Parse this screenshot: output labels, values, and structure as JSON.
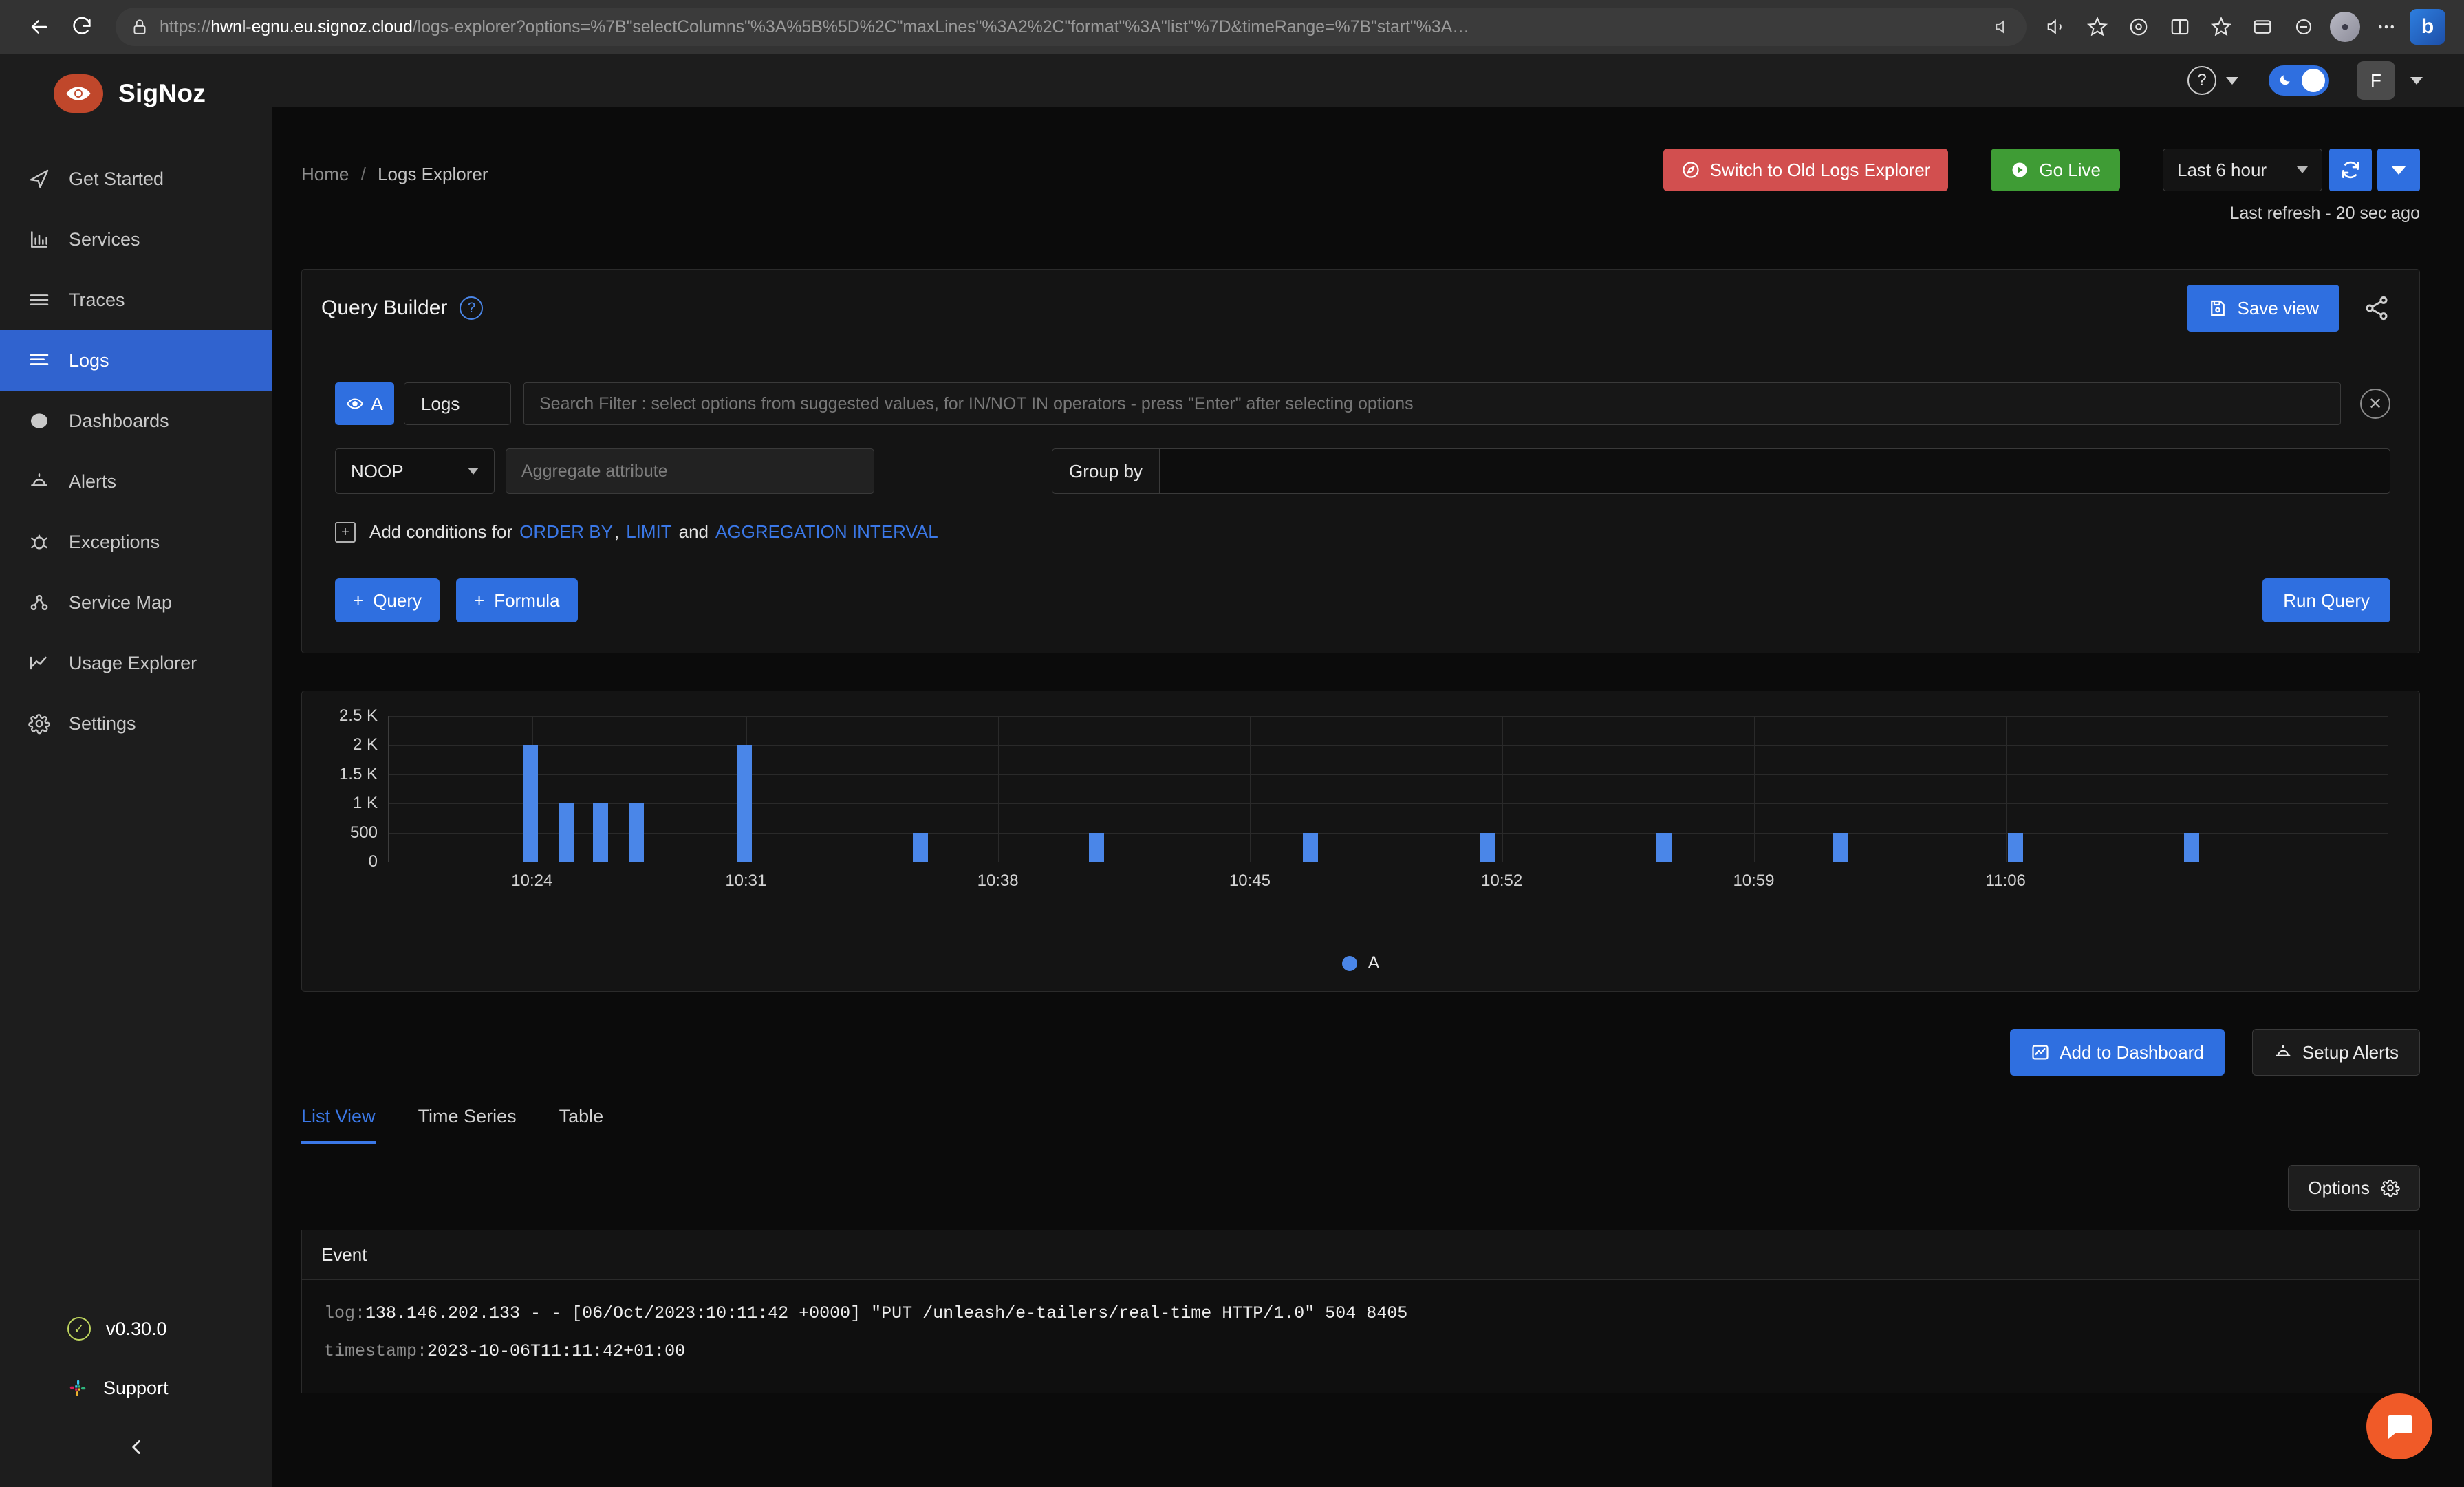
{
  "browser": {
    "url_scheme": "https://",
    "url_host": "hwnl-egnu.eu.signoz.cloud",
    "url_path": "/logs-explorer?options=%7B\"selectColumns\"%3A%5B%5D%2C\"maxLines\"%3A2%2C\"format\"%3A\"list\"%7D&timeRange=%7B\"start\"%3A…",
    "back_icon": "back-arrow-icon",
    "reload_icon": "reload-icon",
    "lock_icon": "lock-icon",
    "icons": [
      "read-aloud-icon",
      "favorite-icon",
      "extensions-icon",
      "split-screen-icon",
      "collections-icon",
      "browser-essentials-icon",
      "copilot-icon",
      "profile-icon",
      "settings-more-icon",
      "bing-chat-icon"
    ]
  },
  "sidebar": {
    "brand": "SigNoz",
    "brand_logo_icon": "signoz-eye-logo",
    "items": [
      {
        "label": "Get Started",
        "icon": "rocket-icon",
        "active": false
      },
      {
        "label": "Services",
        "icon": "bar-chart-icon",
        "active": false
      },
      {
        "label": "Traces",
        "icon": "traces-lines-icon",
        "active": false
      },
      {
        "label": "Logs",
        "icon": "logs-lines-icon",
        "active": true
      },
      {
        "label": "Dashboards",
        "icon": "dashboard-grid-icon",
        "active": false
      },
      {
        "label": "Alerts",
        "icon": "alert-bell-icon",
        "active": false
      },
      {
        "label": "Exceptions",
        "icon": "bug-icon",
        "active": false
      },
      {
        "label": "Service Map",
        "icon": "service-map-icon",
        "active": false
      },
      {
        "label": "Usage Explorer",
        "icon": "line-chart-icon",
        "active": false
      },
      {
        "label": "Settings",
        "icon": "gear-icon",
        "active": false
      }
    ],
    "version": "v0.30.0",
    "version_icon": "check-circle-icon",
    "support": "Support",
    "support_icon": "slack-icon",
    "collapse_icon": "chevron-left-icon"
  },
  "topbar": {
    "help_icon": "question-circle-icon",
    "help_caret_icon": "chevron-down-icon",
    "theme_toggle_icon": "dark-mode-toggle",
    "theme_toggle_on": true,
    "user_initial": "F",
    "user_caret_icon": "chevron-down-icon"
  },
  "header": {
    "breadcrumb_home": "Home",
    "breadcrumb_sep": "/",
    "breadcrumb_current": "Logs Explorer",
    "switch_old_label": "Switch to Old Logs Explorer",
    "switch_old_icon": "compass-icon",
    "go_live_label": "Go Live",
    "go_live_icon": "play-circle-icon",
    "time_range": "Last 6 hour",
    "time_range_caret_icon": "chevron-down-icon",
    "refresh_icon": "refresh-icon",
    "refresh_dropdown_icon": "caret-down-icon",
    "last_refresh": "Last refresh - 20 sec ago"
  },
  "query_builder": {
    "title": "Query Builder",
    "help_icon": "question-circle-icon",
    "save_view_label": "Save view",
    "save_view_icon": "save-disk-icon",
    "share_icon": "share-icon",
    "query_letter": "A",
    "query_eye_icon": "eye-icon",
    "data_source": "Logs",
    "search_placeholder": "Search Filter : select options from suggested values, for IN/NOT IN operators - press \"Enter\" after selecting options",
    "search_value": "",
    "clear_icon": "close-circle-icon",
    "aggregate_op": "NOOP",
    "aggregate_op_caret_icon": "chevron-down-icon",
    "aggregate_attr_placeholder": "Aggregate attribute",
    "aggregate_attr_value": "",
    "group_by_label": "Group by",
    "group_by_value": "",
    "add_conditions_prefix": "Add conditions for",
    "add_conditions_icon": "plus-box-icon",
    "link_order_by": "ORDER BY",
    "link_comma": ",",
    "link_limit": "LIMIT",
    "link_and": "and",
    "link_agg_interval": "AGGREGATION INTERVAL",
    "add_query_label": "Query",
    "add_formula_label": "Formula",
    "run_query_label": "Run Query"
  },
  "chart_data": {
    "type": "bar",
    "title": "",
    "xlabel": "",
    "ylabel": "",
    "ylim": [
      0,
      2500
    ],
    "yticks": [
      0,
      500,
      1000,
      1500,
      2000,
      2500
    ],
    "ytick_labels": [
      "0",
      "500",
      "1 K",
      "1.5 K",
      "2 K",
      "2.5 K"
    ],
    "xtick_labels": [
      "10:24",
      "10:31",
      "10:38",
      "10:45",
      "10:52",
      "10:59",
      "11:06"
    ],
    "xtick_positions_pct": [
      7.2,
      17.9,
      30.5,
      43.1,
      55.7,
      68.3,
      80.9
    ],
    "grid": true,
    "legend_position": "bottom",
    "series": [
      {
        "name": "A",
        "color": "#4a86e8",
        "points": [
          {
            "x_pct": 7.1,
            "value": 2000
          },
          {
            "x_pct": 8.9,
            "value": 1000
          },
          {
            "x_pct": 10.6,
            "value": 1000
          },
          {
            "x_pct": 12.4,
            "value": 1000
          },
          {
            "x_pct": 17.8,
            "value": 2000
          },
          {
            "x_pct": 26.6,
            "value": 500
          },
          {
            "x_pct": 35.4,
            "value": 500
          },
          {
            "x_pct": 46.1,
            "value": 500
          },
          {
            "x_pct": 55.0,
            "value": 500
          },
          {
            "x_pct": 63.8,
            "value": 500
          },
          {
            "x_pct": 72.6,
            "value": 500
          },
          {
            "x_pct": 81.4,
            "value": 500
          },
          {
            "x_pct": 90.2,
            "value": 500
          }
        ]
      }
    ]
  },
  "actions": {
    "add_dashboard_label": "Add to Dashboard",
    "add_dashboard_icon": "chart-icon",
    "setup_alerts_label": "Setup Alerts",
    "setup_alerts_icon": "alert-bell-icon"
  },
  "tabs": [
    {
      "label": "List View",
      "active": true
    },
    {
      "label": "Time Series",
      "active": false
    },
    {
      "label": "Table",
      "active": false
    }
  ],
  "options": {
    "label": "Options",
    "icon": "gear-icon"
  },
  "log_table": {
    "column_header": "Event",
    "rows": [
      {
        "log_key": "log:",
        "log_value": "138.146.202.133 - - [06/Oct/2023:10:11:42 +0000] \"PUT /unleash/e-tailers/real-time HTTP/1.0\" 504 8405",
        "timestamp_key": "timestamp:",
        "timestamp_value": "2023-10-06T11:11:42+01:00"
      }
    ]
  },
  "chat": {
    "icon": "chat-bubble-icon",
    "color": "#f05a28"
  }
}
